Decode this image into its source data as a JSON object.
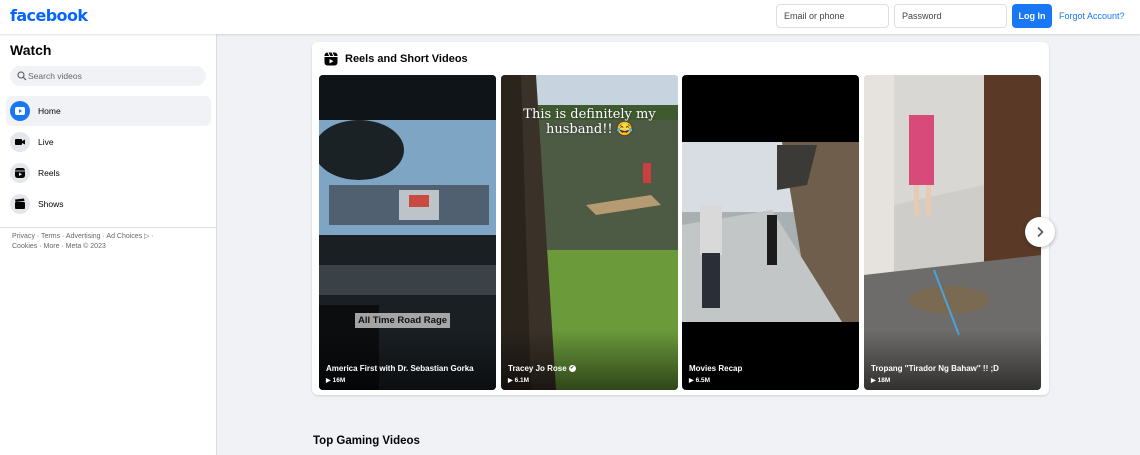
{
  "header": {
    "logo": "facebook",
    "email_placeholder": "Email or phone",
    "password_placeholder": "Password",
    "login_label": "Log In",
    "forgot_label": "Forgot Account?"
  },
  "sidebar": {
    "title": "Watch",
    "search_placeholder": "Search videos",
    "items": [
      {
        "label": "Home",
        "icon": "play-icon",
        "active": true
      },
      {
        "label": "Live",
        "icon": "live-camera-icon",
        "active": false
      },
      {
        "label": "Reels",
        "icon": "reels-icon",
        "active": false
      },
      {
        "label": "Shows",
        "icon": "clapperboard-icon",
        "active": false
      }
    ],
    "footer": "Privacy · Terms · Advertising · Ad Choices ▷ · Cookies · More · Meta © 2023"
  },
  "reels_section": {
    "title": "Reels and Short Videos",
    "reels": [
      {
        "name": "America First with Dr. Sebastian Gorka",
        "views": "16M",
        "overlay": "All Time Road Rage",
        "verified": false
      },
      {
        "name": "Tracey Jo Rose",
        "views": "6.1M",
        "overlay": "This is definitely my husband!! 😂",
        "verified": true
      },
      {
        "name": "Movies Recap",
        "views": "6.5M",
        "verified": false
      },
      {
        "name": "Tropang ''Tirador Ng Bahaw'' !! ;D",
        "views": "18M",
        "verified": false
      }
    ]
  },
  "gaming_section": {
    "title": "Top Gaming Videos"
  },
  "colors": {
    "brand": "#0866ff",
    "button": "#1877f2",
    "background": "#f0f2f5"
  }
}
